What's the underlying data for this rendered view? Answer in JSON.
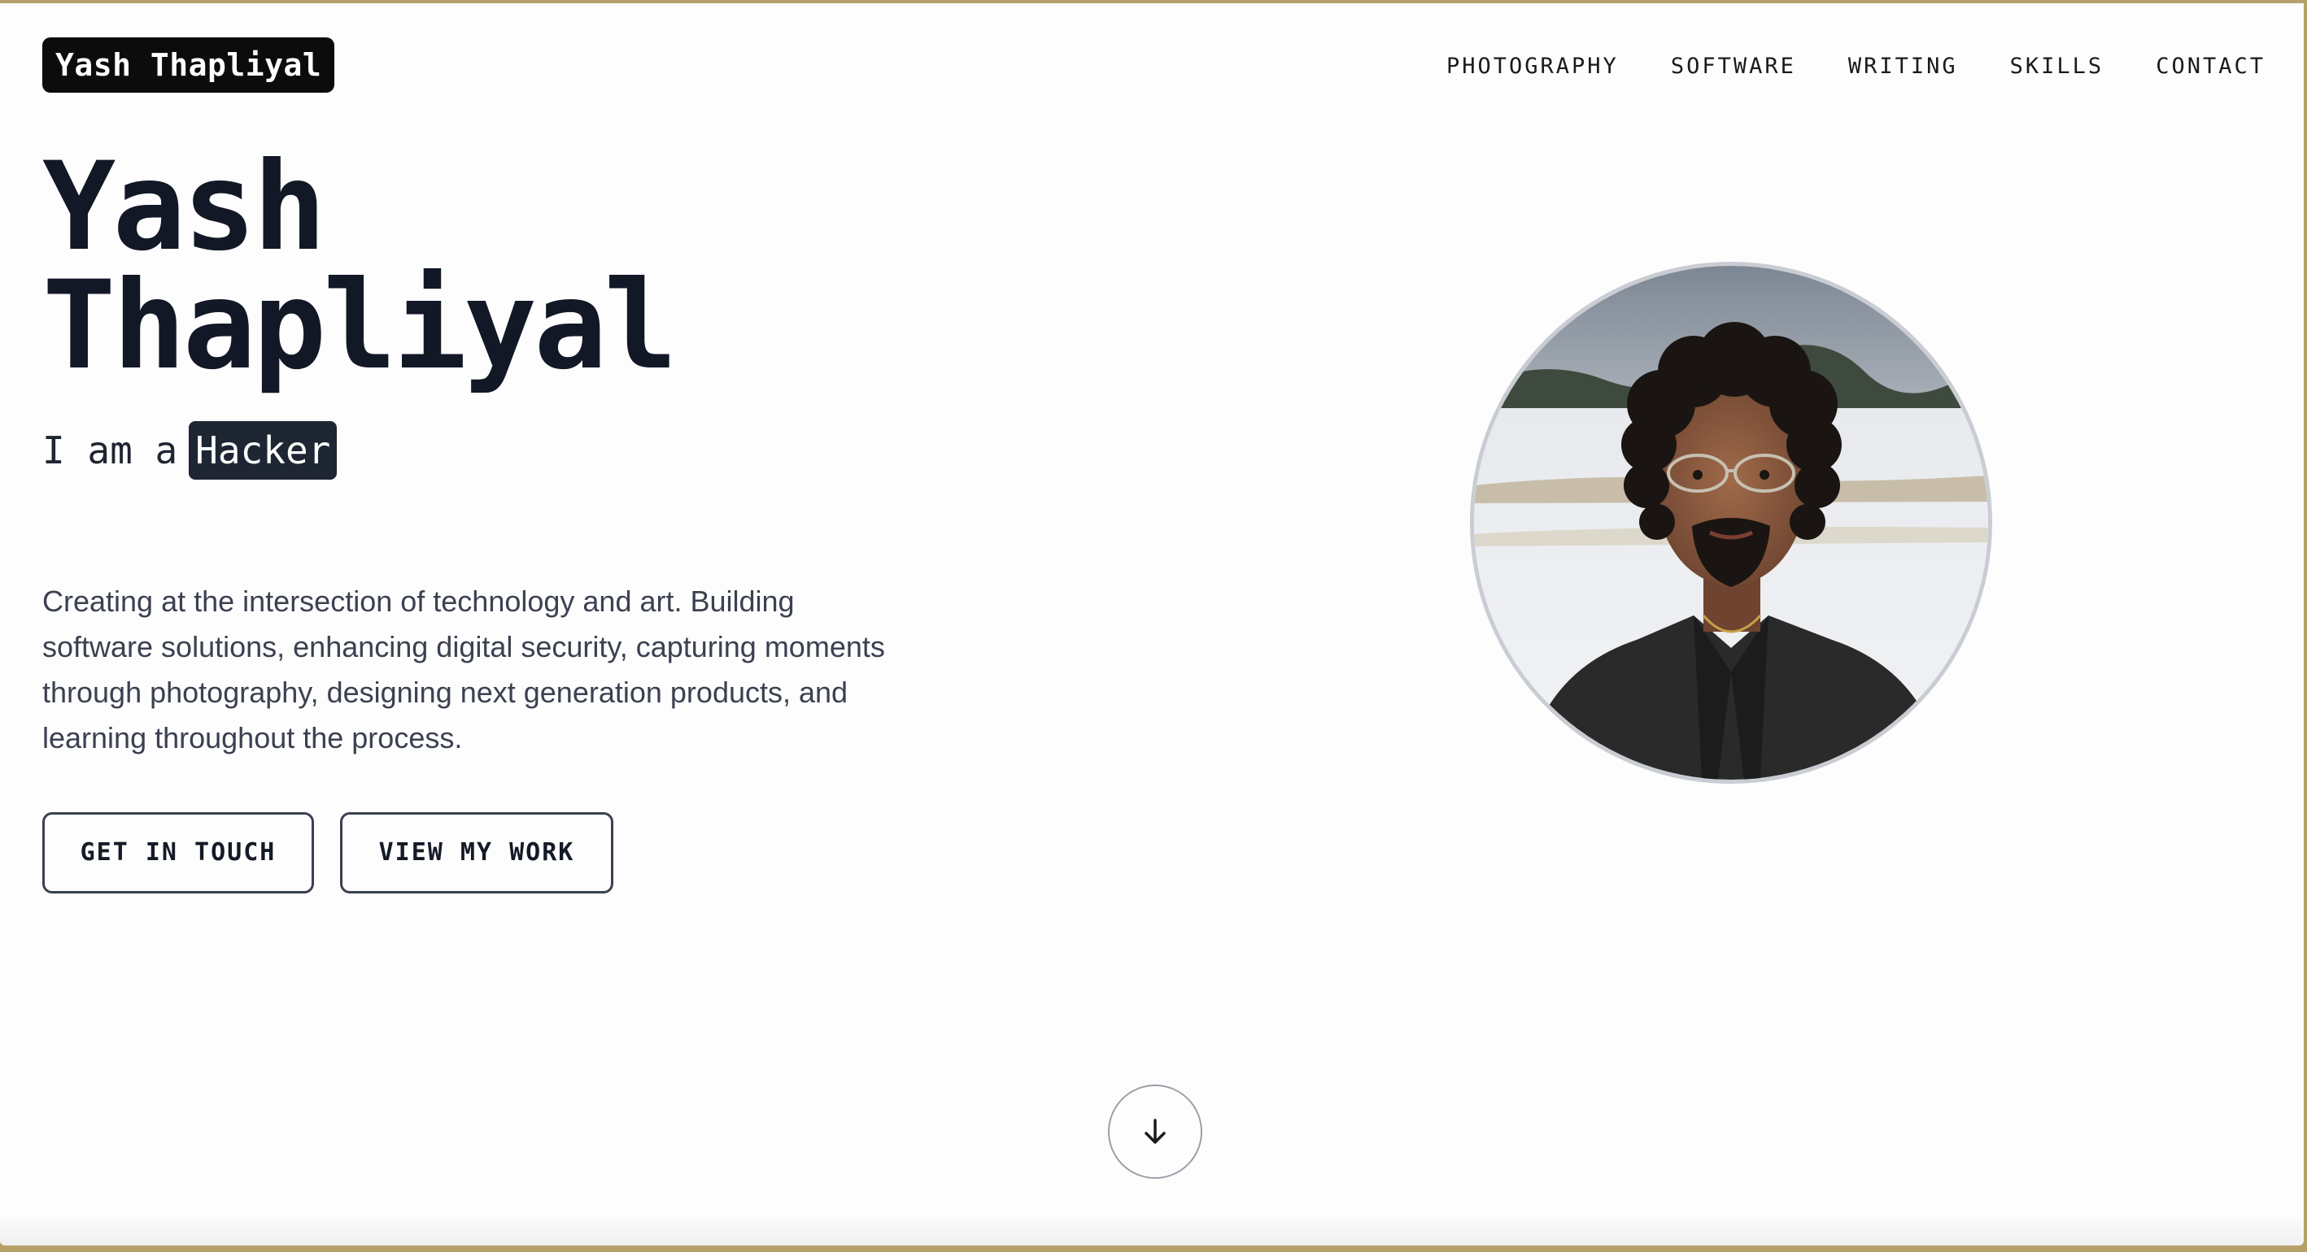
{
  "logo": {
    "text": "Yash Thapliyal"
  },
  "nav": {
    "items": [
      {
        "label": "PHOTOGRAPHY"
      },
      {
        "label": "SOFTWARE"
      },
      {
        "label": "WRITING"
      },
      {
        "label": "SKILLS"
      },
      {
        "label": "CONTACT"
      }
    ]
  },
  "hero": {
    "first_name": "Yash",
    "last_name": "Thapliyal",
    "tagline_prefix": "I am a",
    "tagline_role": "Hacker",
    "intro": "Creating at the intersection of technology and art. Building software solutions, enhancing digital security, capturing moments through photography, designing next generation products, and learning throughout the process."
  },
  "buttons": {
    "get_in_touch": "GET IN TOUCH",
    "view_my_work": "VIEW MY WORK"
  },
  "icons": {
    "scroll": "arrow-down-icon",
    "portrait": "profile-photo"
  },
  "colors": {
    "text_primary": "#121826",
    "text_body": "#3b4150",
    "accent_dark": "#1f2633",
    "border": "#3a4150",
    "frame_border": "#b5a06a"
  }
}
